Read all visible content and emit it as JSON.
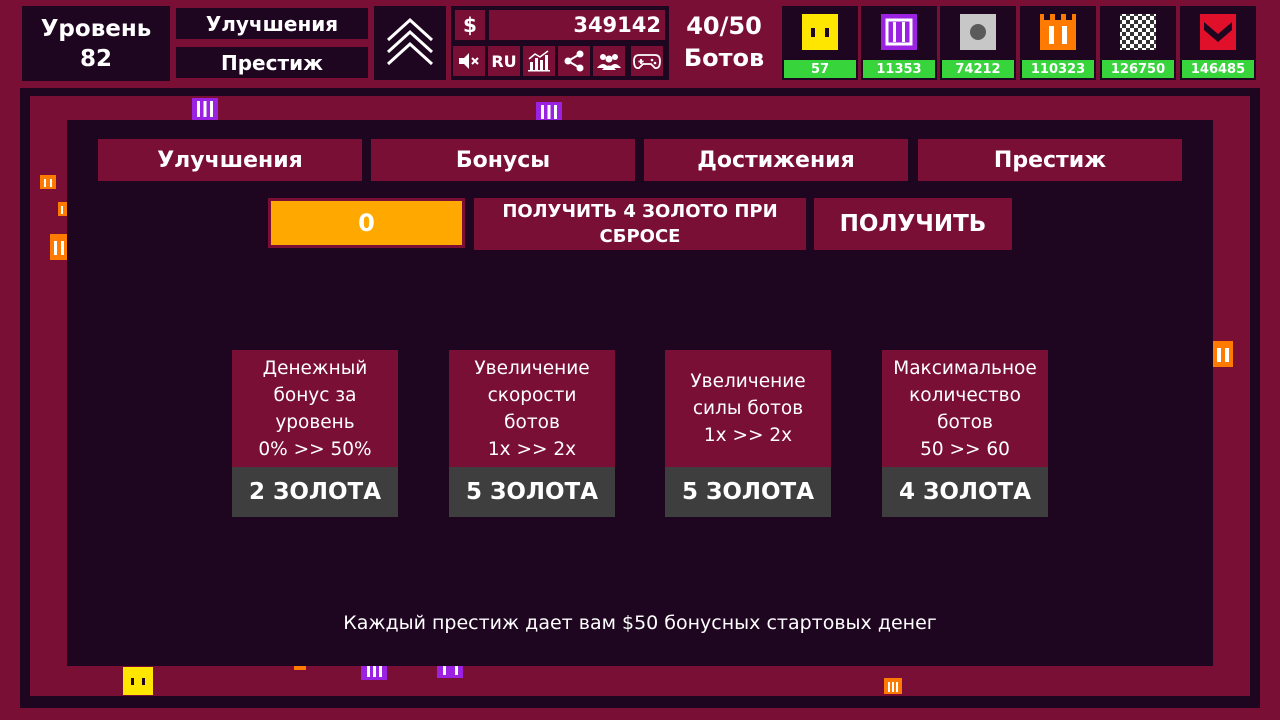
{
  "header": {
    "level_label": "Уровень",
    "level_value": "82",
    "upgrades_button": "Улучшения",
    "prestige_button": "Престиж",
    "currency_symbol": "$",
    "money": "349142",
    "language": "RU",
    "bots_count": "40/50",
    "bots_label": "Ботов"
  },
  "units": [
    {
      "name": "yellow-bot-icon",
      "count": "57"
    },
    {
      "name": "purple-bot-icon",
      "count": "11353"
    },
    {
      "name": "gray-bot-icon",
      "count": "74212"
    },
    {
      "name": "orange-bot-icon",
      "count": "110323"
    },
    {
      "name": "checker-bot-icon",
      "count": "126750"
    },
    {
      "name": "red-bot-icon",
      "count": "146485"
    }
  ],
  "modal": {
    "tabs": [
      "Улучшения",
      "Бонусы",
      "Достижения",
      "Престиж"
    ],
    "gold_amount": "0",
    "reset_info": "ПОЛУЧИТЬ 4 ЗОЛОТО ПРИ СБРОСЕ",
    "claim_button": "ПОЛУЧИТЬ",
    "cards": [
      {
        "desc": "Денежный\nбонус за\nуровень\n0% >> 50%",
        "cost": "2 ЗОЛОТА"
      },
      {
        "desc": "Увеличение\nскорости\nботов\n1x >> 2x",
        "cost": "5 ЗОЛОТА"
      },
      {
        "desc": "Увеличение\nсилы ботов\n1x >> 2x",
        "cost": "5 ЗОЛОТА"
      },
      {
        "desc": "Максимальное\nколичество\nботов\n50 >> 60",
        "cost": "4 ЗОЛОТА"
      }
    ],
    "footer": "Каждый престиж дает вам $50 бонусных стартовых денег"
  },
  "colors": {
    "background": "#7a0f36",
    "panel": "#1f0620",
    "gold": "#ffa900",
    "cost_bg": "#3e3e3e",
    "count_bg": "#37d43c"
  }
}
